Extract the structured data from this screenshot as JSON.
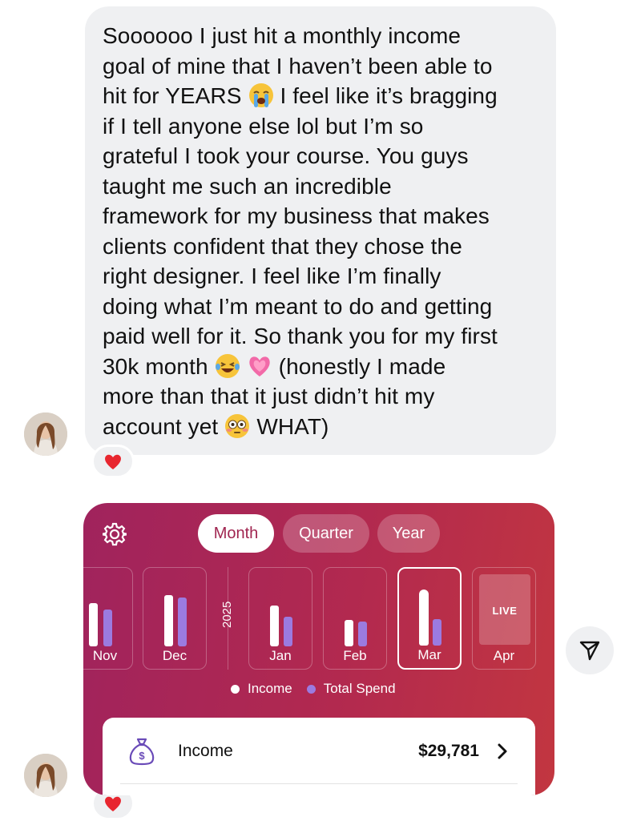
{
  "message": {
    "lines": [
      "Soooooo I just hit a monthly income",
      "goal of mine that I haven’t been able to",
      "hit for YEARS",
      "I feel like it’s bragging",
      "if I tell anyone else lol but I’m so",
      "grateful I took your course. You guys",
      "taught me such an incredible",
      "framework for my business that makes",
      "clients confident that they chose the",
      "right designer. I feel like I’m finally",
      "doing what I’m meant to do and getting",
      "paid well for it. So thank you for my first",
      "30k month",
      "(honestly I made",
      "more than that it just didn’t hit my",
      "account yet",
      "WHAT)"
    ],
    "emojis": [
      "loudly-crying-face",
      "face-with-tears-of-joy",
      "growing-heart",
      "flushed-face"
    ],
    "reaction": "red-heart"
  },
  "card": {
    "tabs": [
      "Month",
      "Quarter",
      "Year"
    ],
    "selected_tab": "Month",
    "year_label": "2025",
    "months": [
      "Nov",
      "Dec",
      "Jan",
      "Feb",
      "Mar",
      "Apr"
    ],
    "selected_month": "Mar",
    "live_label": "LIVE",
    "legend": [
      "Income",
      "Total Spend"
    ],
    "income_label": "Income",
    "income_value": "$29,781",
    "colors": {
      "income": "#ffffff",
      "spend": "#9b7be0",
      "card_start": "#a0235d",
      "card_end": "#c23640"
    }
  },
  "chart_data": {
    "type": "bar",
    "categories": [
      "Nov",
      "Dec",
      "Jan",
      "Feb",
      "Mar",
      "Apr"
    ],
    "series": [
      {
        "name": "Income",
        "values": [
          0.65,
          0.78,
          0.62,
          0.4,
          1.0,
          0
        ]
      },
      {
        "name": "Total Spend",
        "values": [
          0.55,
          0.74,
          0.45,
          0.38,
          0.4,
          0
        ]
      }
    ],
    "ylim": [
      0,
      1
    ],
    "legend": "bottom"
  },
  "icons": {
    "settings": "gear-icon",
    "money_bag": "money-bag-icon",
    "share": "paper-plane-icon",
    "chevron": "chevron-right-icon"
  }
}
